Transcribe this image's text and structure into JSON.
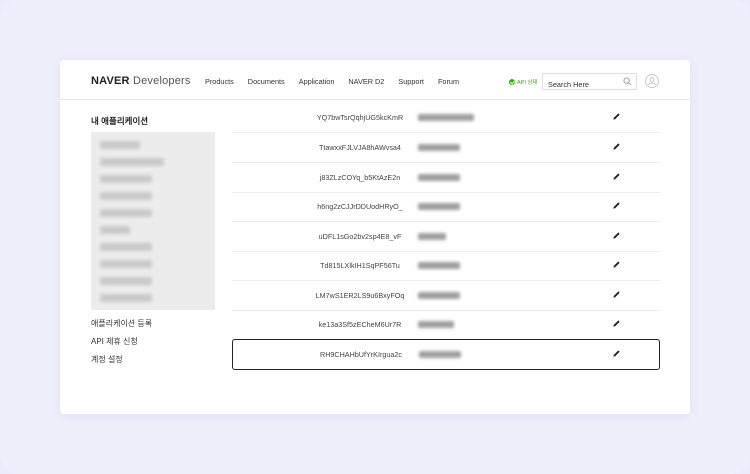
{
  "header": {
    "logo_brand": "NAVER",
    "logo_sub": "Developers",
    "nav": [
      "Products",
      "Documents",
      "Application",
      "NAVER D2",
      "Support",
      "Forum"
    ],
    "status_label": "API 상태",
    "search_placeholder": "Search Here"
  },
  "sidebar": {
    "title": "내 애플리케이션",
    "links": [
      "애플리케이션 등록",
      "API 제휴 신청",
      "계정 설정"
    ]
  },
  "table": {
    "rows": [
      {
        "client_id": "YQ7bwTsrQqhjUG5kcKmR"
      },
      {
        "client_id": "TtawxxFJLVJA8hAWvsa4"
      },
      {
        "client_id": "j83ZLzCOYq_b5KtAzE2n"
      },
      {
        "client_id": "h6ng2zCJJrDDUodHRyO_"
      },
      {
        "client_id": "uDFL1sGo2bv2sp4E8_vF"
      },
      {
        "client_id": "Td815LXlkIH1SqPF56Tu"
      },
      {
        "client_id": "LM7wS1ER2LS9u6BxyFOq"
      },
      {
        "client_id": "ke13a3Sf5zECheM6Ur7R"
      },
      {
        "client_id": "RH9CHAHbUfYrKIrgua2c"
      }
    ],
    "selected_index": 8
  },
  "colors": {
    "background": "#ecebfa",
    "status_green": "#2db400",
    "selected_border": "#222222"
  },
  "icons": {
    "status": "check-circle-icon",
    "search": "search-icon",
    "user": "user-avatar-icon",
    "edit": "pencil-icon"
  }
}
